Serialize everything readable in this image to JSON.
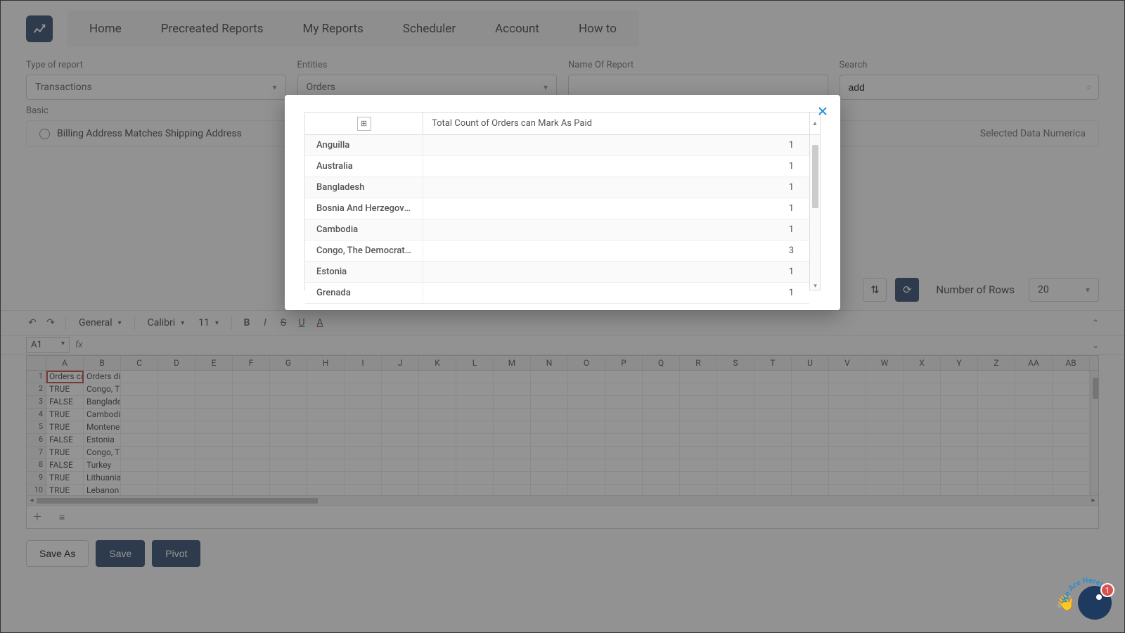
{
  "nav": {
    "tabs": [
      "Home",
      "Precreated Reports",
      "My Reports",
      "Scheduler",
      "Account",
      "How to"
    ]
  },
  "filters": {
    "type_label": "Type of report",
    "type_value": "Transactions",
    "entities_label": "Entities",
    "entities_value": "Orders",
    "name_label": "Name Of Report",
    "name_value": "",
    "search_label": "Search",
    "search_value": "add"
  },
  "basic": {
    "label": "Basic",
    "option": "Billing Address Matches Shipping Address",
    "selected_data": "Selected Data Numerica"
  },
  "controls": {
    "rows_label": "Number of Rows",
    "rows_value": "20"
  },
  "ss_toolbar": {
    "format": "General",
    "font": "Calibri",
    "size": "11"
  },
  "formula": {
    "ref": "A1",
    "fx": "fx"
  },
  "grid": {
    "cols": [
      "A",
      "B",
      "C",
      "D",
      "E",
      "F",
      "G",
      "H",
      "I",
      "J",
      "K",
      "L",
      "M",
      "N",
      "O",
      "P",
      "Q",
      "R",
      "S",
      "T",
      "U",
      "V",
      "W",
      "X",
      "Y",
      "Z",
      "AA",
      "AB"
    ],
    "rows": [
      {
        "n": 1,
        "a": "Orders can",
        "b": "Orders dis"
      },
      {
        "n": 2,
        "a": "TRUE",
        "b": "Congo, The"
      },
      {
        "n": 3,
        "a": "FALSE",
        "b": "Banglades"
      },
      {
        "n": 4,
        "a": "TRUE",
        "b": "Cambodia"
      },
      {
        "n": 5,
        "a": "TRUE",
        "b": "Monteneg"
      },
      {
        "n": 6,
        "a": "FALSE",
        "b": "Estonia"
      },
      {
        "n": 7,
        "a": "TRUE",
        "b": "Congo, The"
      },
      {
        "n": 8,
        "a": "FALSE",
        "b": "Turkey"
      },
      {
        "n": 9,
        "a": "TRUE",
        "b": "Lithuania"
      },
      {
        "n": 10,
        "a": "TRUE",
        "b": "Lebanon"
      }
    ]
  },
  "buttons": {
    "save_as": "Save As",
    "save": "Save",
    "pivot": "Pivot"
  },
  "modal": {
    "metric": "Total Count of Orders can Mark As Paid",
    "rows": [
      {
        "label": "Anguilla",
        "value": "1"
      },
      {
        "label": "Australia",
        "value": "1"
      },
      {
        "label": "Bangladesh",
        "value": "1"
      },
      {
        "label": "Bosnia And Herzegovina",
        "value": "1"
      },
      {
        "label": "Cambodia",
        "value": "1"
      },
      {
        "label": "Congo, The Democratic Re…",
        "value": "3"
      },
      {
        "label": "Estonia",
        "value": "1"
      },
      {
        "label": "Grenada",
        "value": "1"
      }
    ]
  },
  "chat": {
    "text": "We Are Here!",
    "badge": "1"
  }
}
